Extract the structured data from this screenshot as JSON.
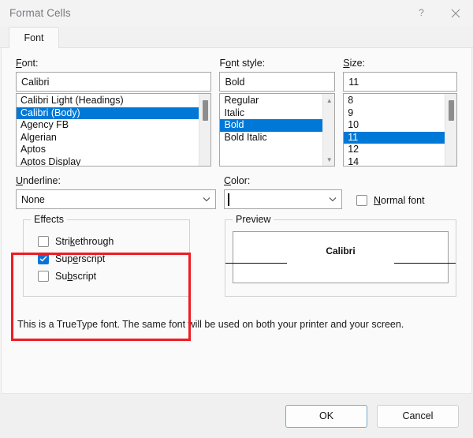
{
  "window": {
    "title": "Format Cells",
    "help_icon": "question-mark-icon",
    "close_icon": "close-icon"
  },
  "tabs": [
    {
      "label": "Font",
      "active": true
    }
  ],
  "font_section": {
    "label": "Font:",
    "value": "Calibri",
    "items": [
      "Calibri Light (Headings)",
      "Calibri (Body)",
      "Agency FB",
      "Algerian",
      "Aptos",
      "Aptos Display"
    ],
    "selected": "Calibri (Body)"
  },
  "style_section": {
    "label": "Font style:",
    "value": "Bold",
    "items": [
      "Regular",
      "Italic",
      "Bold",
      "Bold Italic"
    ],
    "selected": "Bold"
  },
  "size_section": {
    "label": "Size:",
    "value": "11",
    "items": [
      "8",
      "9",
      "10",
      "11",
      "12",
      "14"
    ],
    "selected": "11"
  },
  "underline": {
    "label": "Underline:",
    "value": "None"
  },
  "color": {
    "label": "Color:",
    "value": "#000000"
  },
  "normal_font": {
    "label": "Normal font",
    "checked": false
  },
  "effects": {
    "title": "Effects",
    "items": [
      {
        "label": "Strikethrough",
        "checked": false
      },
      {
        "label": "Superscript",
        "checked": true
      },
      {
        "label": "Subscript",
        "checked": false
      }
    ]
  },
  "preview": {
    "title": "Preview",
    "sample_text": "Calibri"
  },
  "info_text": "This is a TrueType font.  The same font will be used on both your printer and your screen.",
  "buttons": {
    "ok": "OK",
    "cancel": "Cancel"
  },
  "colors": {
    "selection_blue": "#0078d7",
    "checkbox_blue": "#0a74d6",
    "annotation_red": "#ee1c23"
  }
}
